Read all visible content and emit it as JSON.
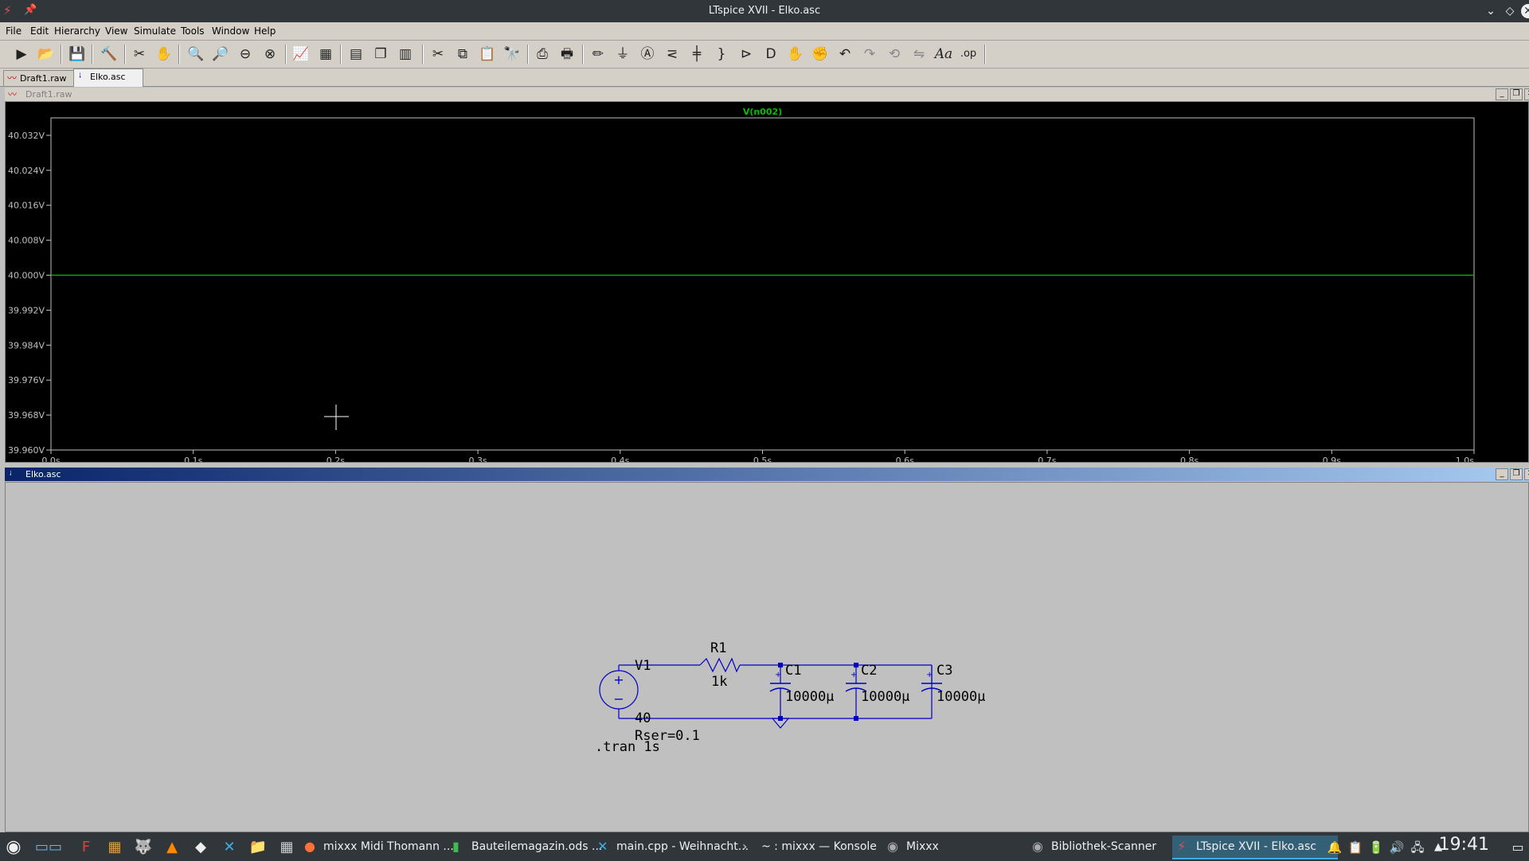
{
  "window": {
    "title": "LTspice XVII - Elko.asc"
  },
  "menu": [
    "File",
    "Edit",
    "Hierarchy",
    "View",
    "Simulate",
    "Tools",
    "Window",
    "Help"
  ],
  "tabs": [
    {
      "label": "Draft1.raw",
      "icon": "waveform-icon"
    },
    {
      "label": "Elko.asc",
      "icon": "schematic-icon"
    }
  ],
  "plot_window": {
    "title": "Draft1.raw"
  },
  "schematic_window": {
    "title": "Elko.asc"
  },
  "chart_data": {
    "type": "line",
    "series": [
      {
        "name": "V(n002)",
        "x": [
          0.0,
          1.0
        ],
        "y": [
          40.0,
          40.0
        ],
        "color": "#00c000"
      }
    ],
    "xticks": [
      "0.0s",
      "0.1s",
      "0.2s",
      "0.3s",
      "0.4s",
      "0.5s",
      "0.6s",
      "0.7s",
      "0.8s",
      "0.9s",
      "1.0s"
    ],
    "yticks": [
      "40.032V",
      "40.024V",
      "40.016V",
      "40.008V",
      "40.000V",
      "39.992V",
      "39.984V",
      "39.976V",
      "39.968V",
      "39.960V"
    ],
    "xlim": [
      0.0,
      1.0
    ],
    "ylim": [
      39.96,
      40.036
    ],
    "grid": false,
    "background": "#000000"
  },
  "schematic": {
    "v1": {
      "name": "V1",
      "value": "40",
      "rser": "Rser=0.1"
    },
    "r1": {
      "name": "R1",
      "value": "1k"
    },
    "c1": {
      "name": "C1",
      "value": "10000µ"
    },
    "c2": {
      "name": "C2",
      "value": "10000µ"
    },
    "c3": {
      "name": "C3",
      "value": "10000µ"
    },
    "directive": ".tran 1s",
    "wire_color": "#0000c0"
  },
  "taskbar": {
    "tasks": [
      {
        "label": "mixxx Midi Thomann ...",
        "icon": "firefox-icon"
      },
      {
        "label": "Bauteilemagazin.ods ...",
        "icon": "spreadsheet-icon"
      },
      {
        "label": "main.cpp - Weihnacht...",
        "icon": "vscode-icon"
      },
      {
        "label": "~ : mixxx — Konsole",
        "icon": "terminal-icon"
      },
      {
        "label": "Mixxx",
        "icon": "mixxx-icon"
      },
      {
        "label": "Bibliothek-Scanner",
        "icon": "mixxx-icon"
      },
      {
        "label": "LTspice XVII - Elko.asc",
        "icon": "ltspice-icon"
      }
    ],
    "clock": "19:41"
  }
}
